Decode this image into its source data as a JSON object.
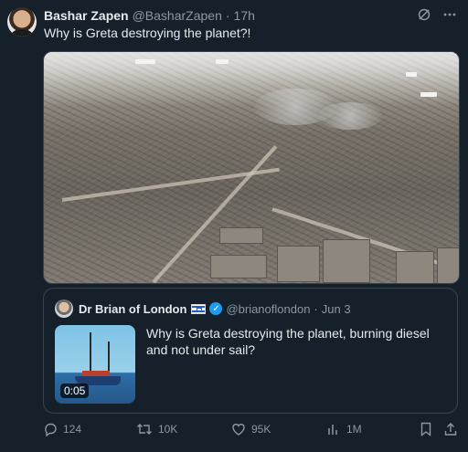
{
  "post": {
    "author_name": "Bashar Zapen",
    "author_handle": "@BasharZapen",
    "separator": "·",
    "timestamp": "17h",
    "text": "Why is Greta destroying the planet?!"
  },
  "quote": {
    "author_name": "Dr Brian of London",
    "flag_icon": "israel-flag",
    "verified": true,
    "author_handle": "@brianoflondon",
    "separator": "·",
    "date": "Jun 3",
    "text": "Why is Greta destroying the planet, burning diesel and not under sail?",
    "video_duration": "0:05"
  },
  "actions": {
    "replies": "124",
    "reposts": "10K",
    "likes": "95K",
    "views": "1M"
  },
  "colors": {
    "background": "#15202b",
    "text": "#e7e9ea",
    "secondary": "#8b98a5",
    "border": "#38444d",
    "verified": "#1d9bf0"
  }
}
